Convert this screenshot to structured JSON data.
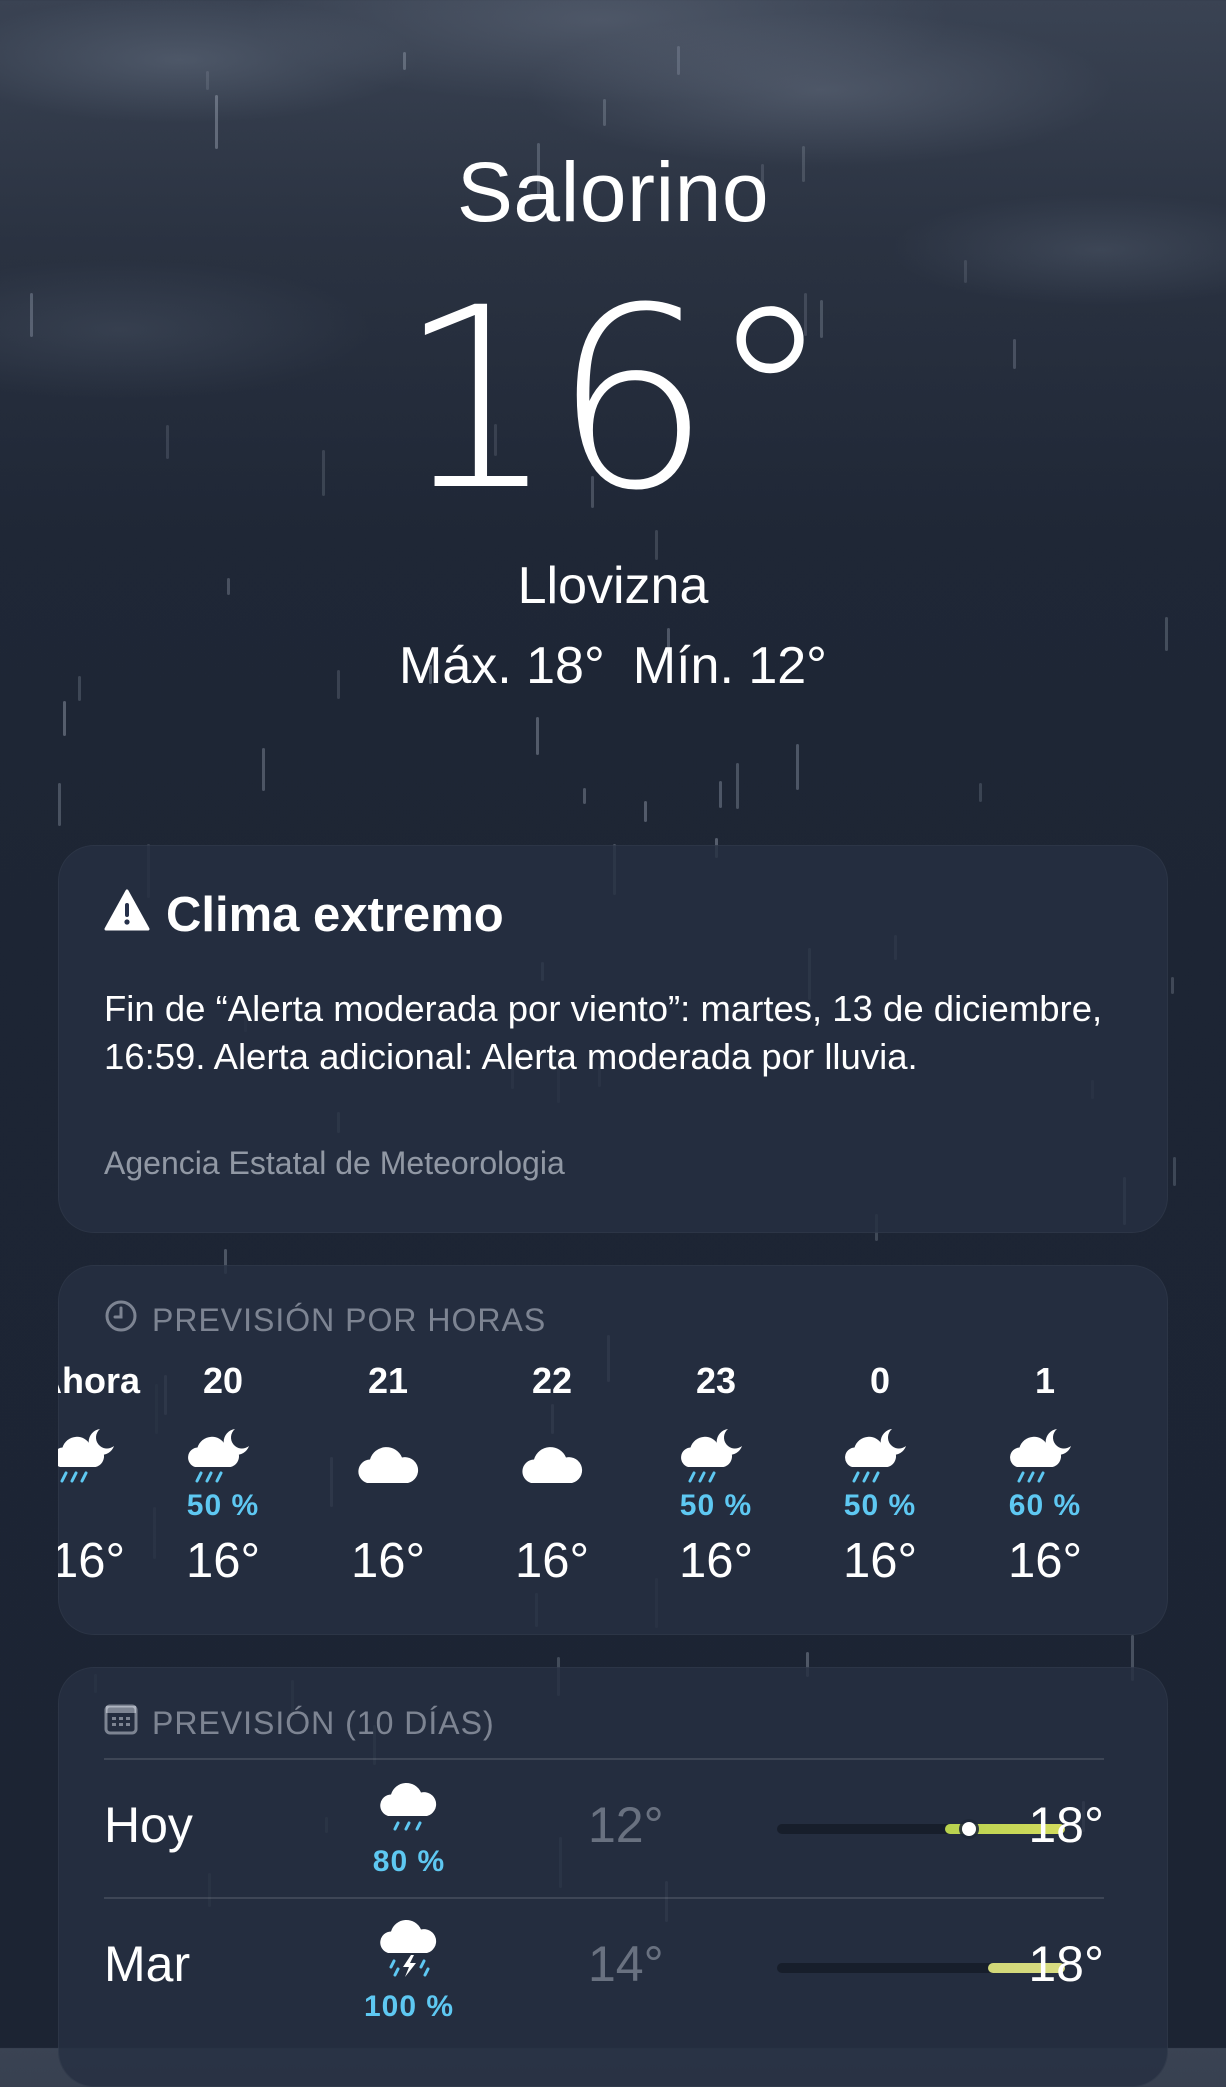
{
  "location": {
    "city": "Salorino",
    "temperature": "16°",
    "condition": "Llovizna",
    "high": "Máx. 18°",
    "low": "Mín. 12°"
  },
  "alert": {
    "icon": "warning-triangle-icon",
    "title": "Clima extremo",
    "body": "Fin de “Alerta moderada por viento”: martes, 13 de diciembre, 16:59. Alerta adicional: Alerta moderada por lluvia.",
    "source": "Agencia Estatal de Meteorologia"
  },
  "hourly": {
    "icon": "clock-icon",
    "title": "PREVISIÓN POR HORAS",
    "items": [
      {
        "time": "Ahora",
        "icon": "partly-cloudy-night-rain-icon",
        "pop": "",
        "temp": "16°"
      },
      {
        "time": "20",
        "icon": "partly-cloudy-night-rain-icon",
        "pop": "50 %",
        "temp": "16°"
      },
      {
        "time": "21",
        "icon": "cloud-icon",
        "pop": "",
        "temp": "16°"
      },
      {
        "time": "22",
        "icon": "cloud-icon",
        "pop": "",
        "temp": "16°"
      },
      {
        "time": "23",
        "icon": "partly-cloudy-night-rain-icon",
        "pop": "50 %",
        "temp": "16°"
      },
      {
        "time": "0",
        "icon": "partly-cloudy-night-rain-icon",
        "pop": "50 %",
        "temp": "16°"
      },
      {
        "time": "1",
        "icon": "partly-cloudy-night-rain-icon",
        "pop": "60 %",
        "temp": "16°"
      }
    ]
  },
  "daily": {
    "icon": "calendar-icon",
    "title": "PREVISIÓN (10 DÍAS)",
    "range": {
      "min": 12,
      "max": 18
    },
    "days": [
      {
        "day": "Hoy",
        "icon": "cloud-drizzle-icon",
        "pop": "80 %",
        "low": "12°",
        "high": "18°",
        "low_value": 12,
        "high_value": 18,
        "current_value": 16,
        "bar_from": 15.5,
        "bar_to": 18,
        "colors": [
          "#b8d24e",
          "#d4dc5e"
        ]
      },
      {
        "day": "Mar",
        "icon": "cloud-bolt-rain-icon",
        "pop": "100 %",
        "low": "14°",
        "high": "18°",
        "low_value": 14,
        "high_value": 18,
        "bar_from": 16.4,
        "bar_to": 18,
        "colors": [
          "#d2d878",
          "#d8dc82"
        ]
      }
    ]
  }
}
